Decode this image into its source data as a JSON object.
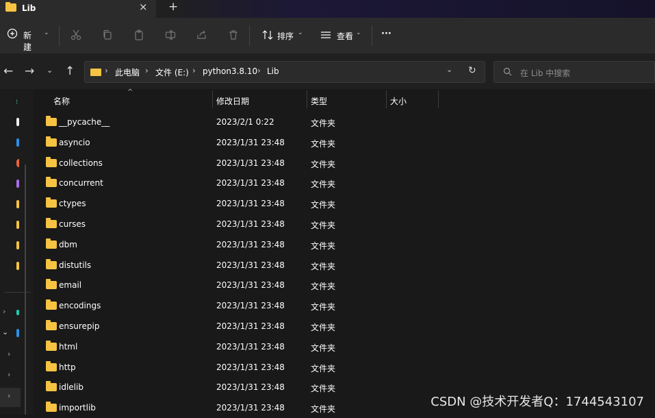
{
  "tab": {
    "title": "Lib",
    "close_icon": "×",
    "new_tab_icon": "+"
  },
  "toolbar": {
    "new_label": "新建",
    "sort_label": "排序",
    "view_label": "查看",
    "more_label": "···"
  },
  "address": {
    "crumbs": [
      "此电脑",
      "文件 (E:)",
      "python3.8.10",
      "Lib"
    ],
    "search_placeholder": "在 Lib 中搜索"
  },
  "columns": {
    "name": "名称",
    "date": "修改日期",
    "type": "类型",
    "size": "大小"
  },
  "rows": [
    {
      "name": "__pycache__",
      "date": "2023/2/1 0:22",
      "type": "文件夹"
    },
    {
      "name": "asyncio",
      "date": "2023/1/31 23:48",
      "type": "文件夹"
    },
    {
      "name": "collections",
      "date": "2023/1/31 23:48",
      "type": "文件夹"
    },
    {
      "name": "concurrent",
      "date": "2023/1/31 23:48",
      "type": "文件夹"
    },
    {
      "name": "ctypes",
      "date": "2023/1/31 23:48",
      "type": "文件夹"
    },
    {
      "name": "curses",
      "date": "2023/1/31 23:48",
      "type": "文件夹"
    },
    {
      "name": "dbm",
      "date": "2023/1/31 23:48",
      "type": "文件夹"
    },
    {
      "name": "distutils",
      "date": "2023/1/31 23:48",
      "type": "文件夹"
    },
    {
      "name": "email",
      "date": "2023/1/31 23:48",
      "type": "文件夹"
    },
    {
      "name": "encodings",
      "date": "2023/1/31 23:48",
      "type": "文件夹"
    },
    {
      "name": "ensurepip",
      "date": "2023/1/31 23:48",
      "type": "文件夹"
    },
    {
      "name": "html",
      "date": "2023/1/31 23:48",
      "type": "文件夹"
    },
    {
      "name": "http",
      "date": "2023/1/31 23:48",
      "type": "文件夹"
    },
    {
      "name": "idlelib",
      "date": "2023/1/31 23:48",
      "type": "文件夹"
    },
    {
      "name": "importlib",
      "date": "2023/1/31 23:48",
      "type": "文件夹"
    }
  ],
  "watermark": "CSDN @技术开发者Q：1744543107",
  "colors": {
    "folder": "#f6c342",
    "background": "#191919",
    "toolbar": "#2b2b2b"
  }
}
